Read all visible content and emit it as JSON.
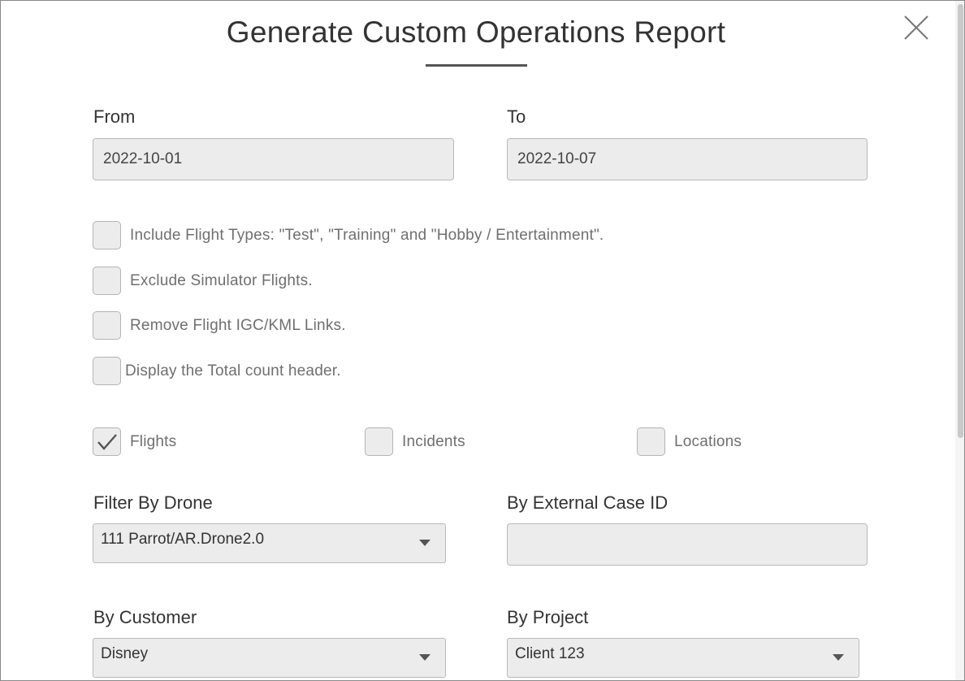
{
  "dialog": {
    "title": "Generate Custom Operations Report",
    "close_icon": "close-icon"
  },
  "date_range": {
    "from_label": "From",
    "from_value": "2022-10-01",
    "to_label": "To",
    "to_value": "2022-10-07"
  },
  "options": [
    {
      "label": "Include Flight Types: \"Test\", \"Training\" and \"Hobby / Entertainment\".",
      "checked": false
    },
    {
      "label": "Exclude Simulator Flights.",
      "checked": false
    },
    {
      "label": "Remove Flight IGC/KML Links.",
      "checked": false
    },
    {
      "label": "Display the Total count header.",
      "checked": false
    }
  ],
  "report_types": [
    {
      "label": "Flights",
      "checked": true
    },
    {
      "label": "Incidents",
      "checked": false
    },
    {
      "label": "Locations",
      "checked": false
    }
  ],
  "filters": {
    "drone_label": "Filter By Drone",
    "drone_value": "111 Parrot/AR.Drone2.0",
    "case_label": "By External Case ID",
    "case_value": "",
    "customer_label": "By Customer",
    "customer_value": "Disney",
    "project_label": "By Project",
    "project_value": "Client 123"
  }
}
